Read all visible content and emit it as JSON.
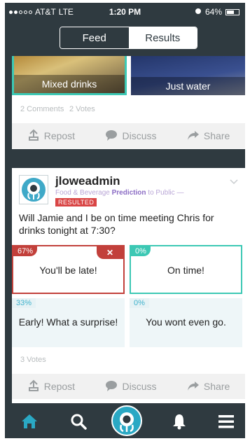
{
  "status_bar": {
    "carrier": "AT&T",
    "network": "LTE",
    "time": "1:20 PM",
    "battery": "64%",
    "battery_level": 0.64
  },
  "segmented": {
    "feed": "Feed",
    "results": "Results"
  },
  "card1": {
    "option_left": "Mixed drinks",
    "option_right": "Just water",
    "comments": "2 Comments",
    "votes": "2 Votes",
    "actions": {
      "repost": "Repost",
      "discuss": "Discuss",
      "share": "Share"
    }
  },
  "card2": {
    "username": "jloweadmin",
    "category": "Food & Beverage",
    "type": "Prediction",
    "audience_prefix": "to",
    "audience": "Public",
    "status": "RESULTED",
    "question": "Will Jamie and I be on time meeting Chris for drinks tonight at 7:30?",
    "options": [
      {
        "pct": "67%",
        "text": "You'll be late!"
      },
      {
        "pct": "0%",
        "text": "On time!"
      },
      {
        "pct": "33%",
        "text": "Early! What a surprise!"
      },
      {
        "pct": "0%",
        "text": "You wont even go."
      }
    ],
    "votes": "3 Votes",
    "actions": {
      "repost": "Repost",
      "discuss": "Discuss",
      "share": "Share"
    }
  },
  "tabbar": {
    "icons": [
      "home-icon",
      "search-icon",
      "logo-icon",
      "bell-icon",
      "menu-icon"
    ]
  },
  "colors": {
    "teal": "#3cc8b4",
    "red": "#c2403b",
    "dark": "#2f3a40",
    "purple": "#8a6bc4"
  }
}
